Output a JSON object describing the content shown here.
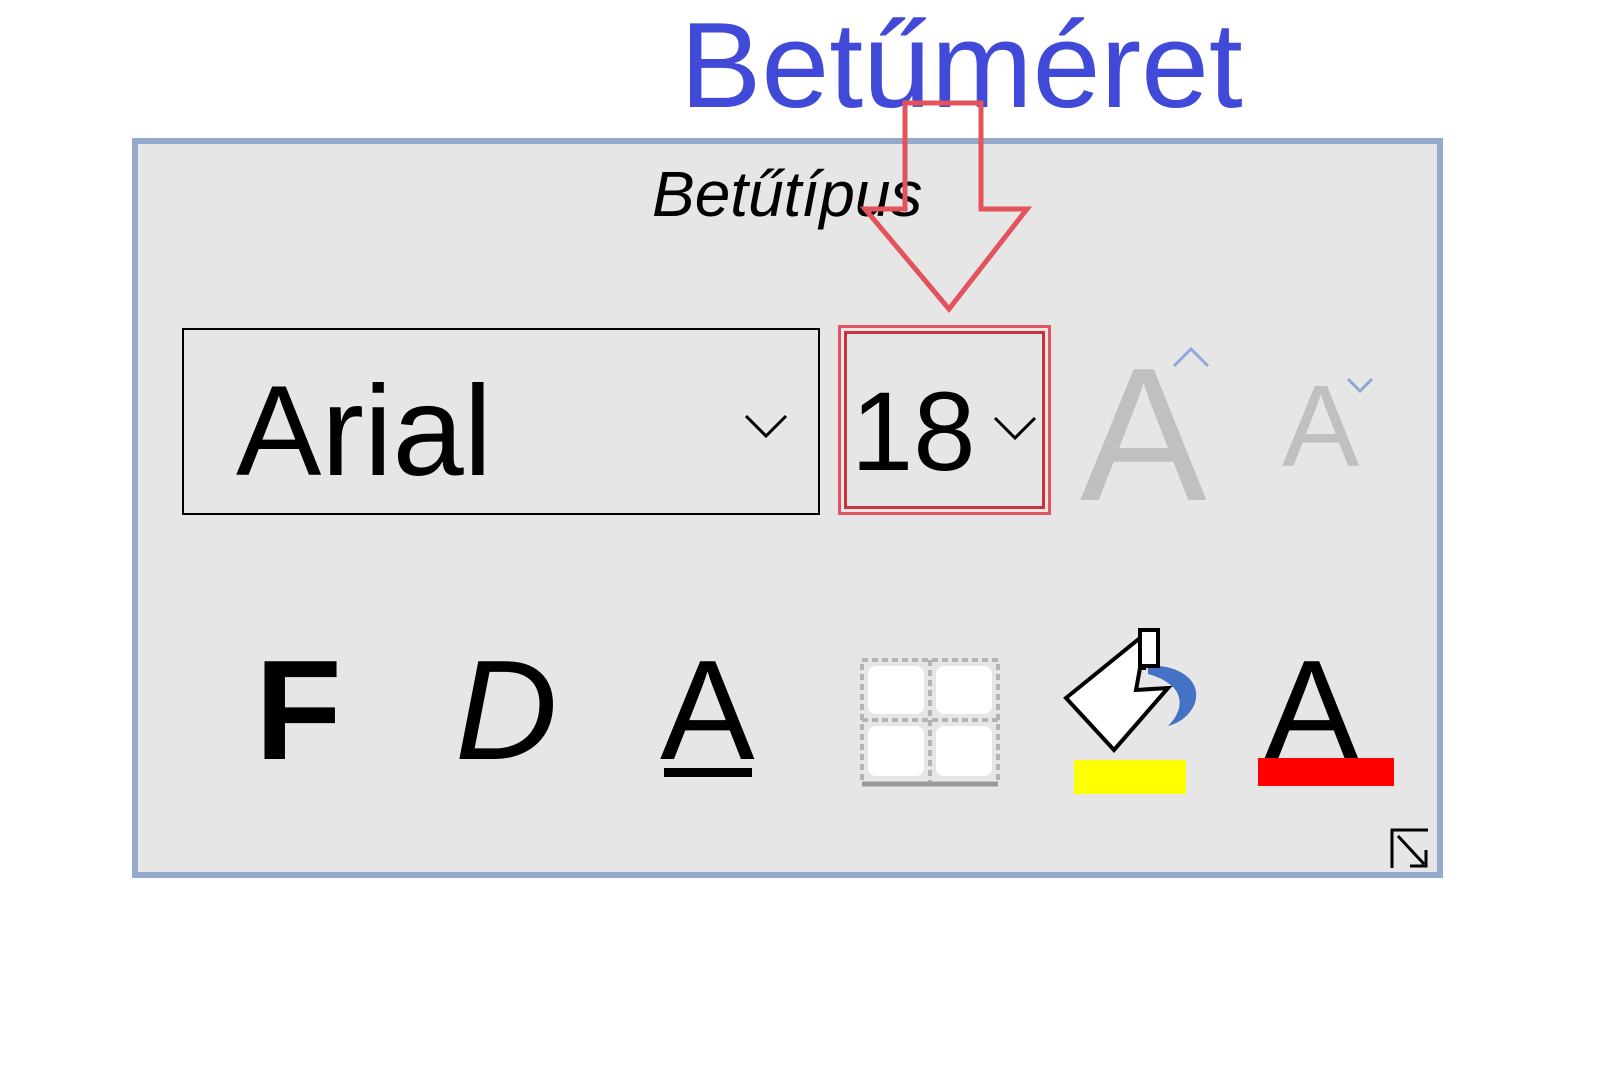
{
  "annotation": {
    "label": "Betűméret",
    "color": "#4149d8",
    "arrow_color": "#e2535c"
  },
  "font_group": {
    "label": "Betűtípus",
    "panel_background": "#e6e6e6",
    "panel_border": "#93aacd",
    "font_name": {
      "value": "Arial",
      "icon": "chevron-down-icon"
    },
    "font_size": {
      "value": "18",
      "icon": "chevron-down-icon",
      "highlight_color": "#e2535c"
    },
    "grow_font": {
      "glyph": "A",
      "icon": "caret-up-icon"
    },
    "shrink_font": {
      "glyph": "A",
      "icon": "caret-down-icon"
    },
    "bold": {
      "glyph": "F"
    },
    "italic": {
      "glyph": "D"
    },
    "underline": {
      "glyph": "A"
    },
    "borders": {
      "icon": "borders-grid-icon"
    },
    "highlight": {
      "icon": "paint-bucket-icon",
      "color": "#ffff00"
    },
    "font_color": {
      "glyph": "A",
      "color": "#ff0000"
    },
    "dialog_launcher": {
      "icon": "dialog-launcher-icon"
    }
  }
}
